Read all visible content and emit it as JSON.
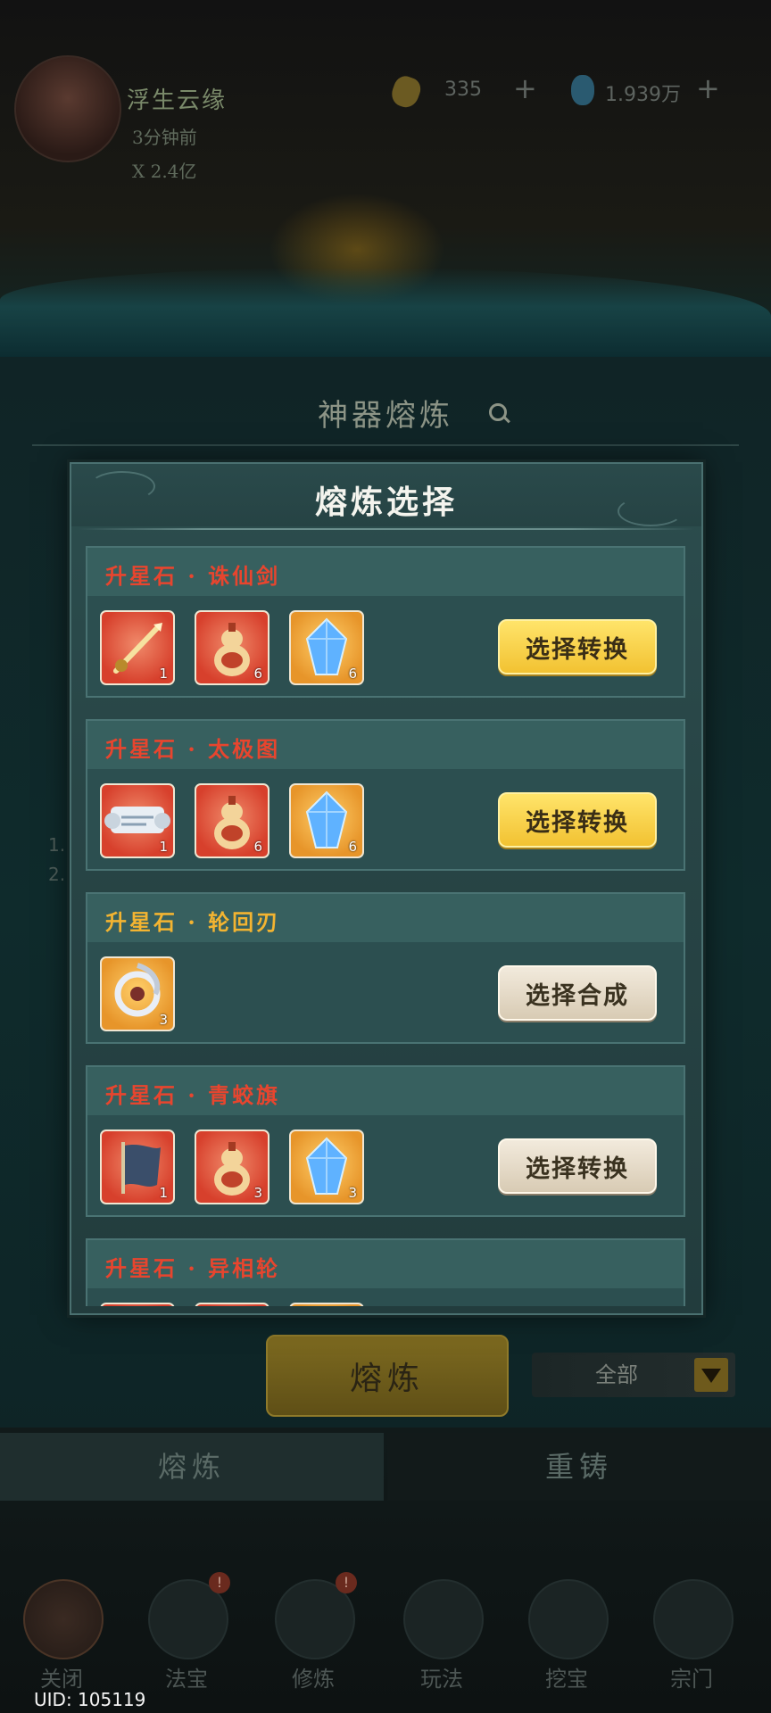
{
  "colors": {
    "title_red": "#e8452e",
    "title_gold": "#f3b431",
    "button_yellow": "#f6cf3e",
    "button_gray": "#e6dcc8",
    "item_red": "#e05a3e",
    "item_gold": "#f0a83a"
  },
  "background": {
    "player": {
      "name": "浮生云缘",
      "subtitle": "3分钟前",
      "stat": "X 2.4亿"
    },
    "resources": [
      {
        "icon": "gold-ingot-icon",
        "value": "335",
        "plus": "+"
      },
      {
        "icon": "spirit-crystal-icon",
        "value": "1.939万",
        "plus": "+"
      }
    ],
    "panel_title": "神器熔炼",
    "notes": [
      "1.",
      "2."
    ],
    "smelt_button": "熔炼",
    "filter_label": "全部",
    "tabs": [
      "熔炼",
      "重铸"
    ],
    "nav": [
      {
        "label": "关闭",
        "icon": "close-icon",
        "badge": ""
      },
      {
        "label": "法宝",
        "icon": "treasure-icon",
        "badge": "!"
      },
      {
        "label": "修炼",
        "icon": "cultivate-icon",
        "badge": "!"
      },
      {
        "label": "玩法",
        "icon": "gameplay-icon",
        "badge": ""
      },
      {
        "label": "挖宝",
        "icon": "shovel-icon",
        "badge": ""
      },
      {
        "label": "宗门",
        "icon": "sect-icon",
        "badge": ""
      }
    ],
    "uid": "UID: 105119"
  },
  "modal": {
    "title": "熔炼选择",
    "entries": [
      {
        "title": "升星石 · 诛仙剑",
        "title_color": "red",
        "items": [
          {
            "icon": "sword-icon",
            "bg": "red",
            "count": "1"
          },
          {
            "icon": "gourd-icon",
            "bg": "red",
            "count": "6"
          },
          {
            "icon": "crystal-icon",
            "bg": "gold",
            "count": "6"
          }
        ],
        "button": "选择转换",
        "button_style": "yellow"
      },
      {
        "title": "升星石 · 太极图",
        "title_color": "red",
        "items": [
          {
            "icon": "scroll-icon",
            "bg": "red",
            "count": "1"
          },
          {
            "icon": "gourd-icon",
            "bg": "red",
            "count": "6"
          },
          {
            "icon": "crystal-icon",
            "bg": "gold",
            "count": "6"
          }
        ],
        "button": "选择转换",
        "button_style": "yellow"
      },
      {
        "title": "升星石 · 轮回刃",
        "title_color": "gold",
        "items": [
          {
            "icon": "blade-wheel-icon",
            "bg": "gold",
            "count": "3"
          }
        ],
        "button": "选择合成",
        "button_style": "gray"
      },
      {
        "title": "升星石 · 青蛟旗",
        "title_color": "red",
        "items": [
          {
            "icon": "flag-icon",
            "bg": "red",
            "count": "1"
          },
          {
            "icon": "gourd-icon",
            "bg": "red",
            "count": "3"
          },
          {
            "icon": "crystal-icon",
            "bg": "gold",
            "count": "3"
          }
        ],
        "button": "选择转换",
        "button_style": "gray"
      },
      {
        "title": "升星石 · 异相轮",
        "title_color": "red",
        "items": [
          {
            "icon": "wheel-icon",
            "bg": "red",
            "count": ""
          },
          {
            "icon": "gourd-icon",
            "bg": "red",
            "count": ""
          },
          {
            "icon": "crystal-icon",
            "bg": "gold",
            "count": ""
          }
        ],
        "button": "",
        "button_style": "gray"
      }
    ]
  }
}
